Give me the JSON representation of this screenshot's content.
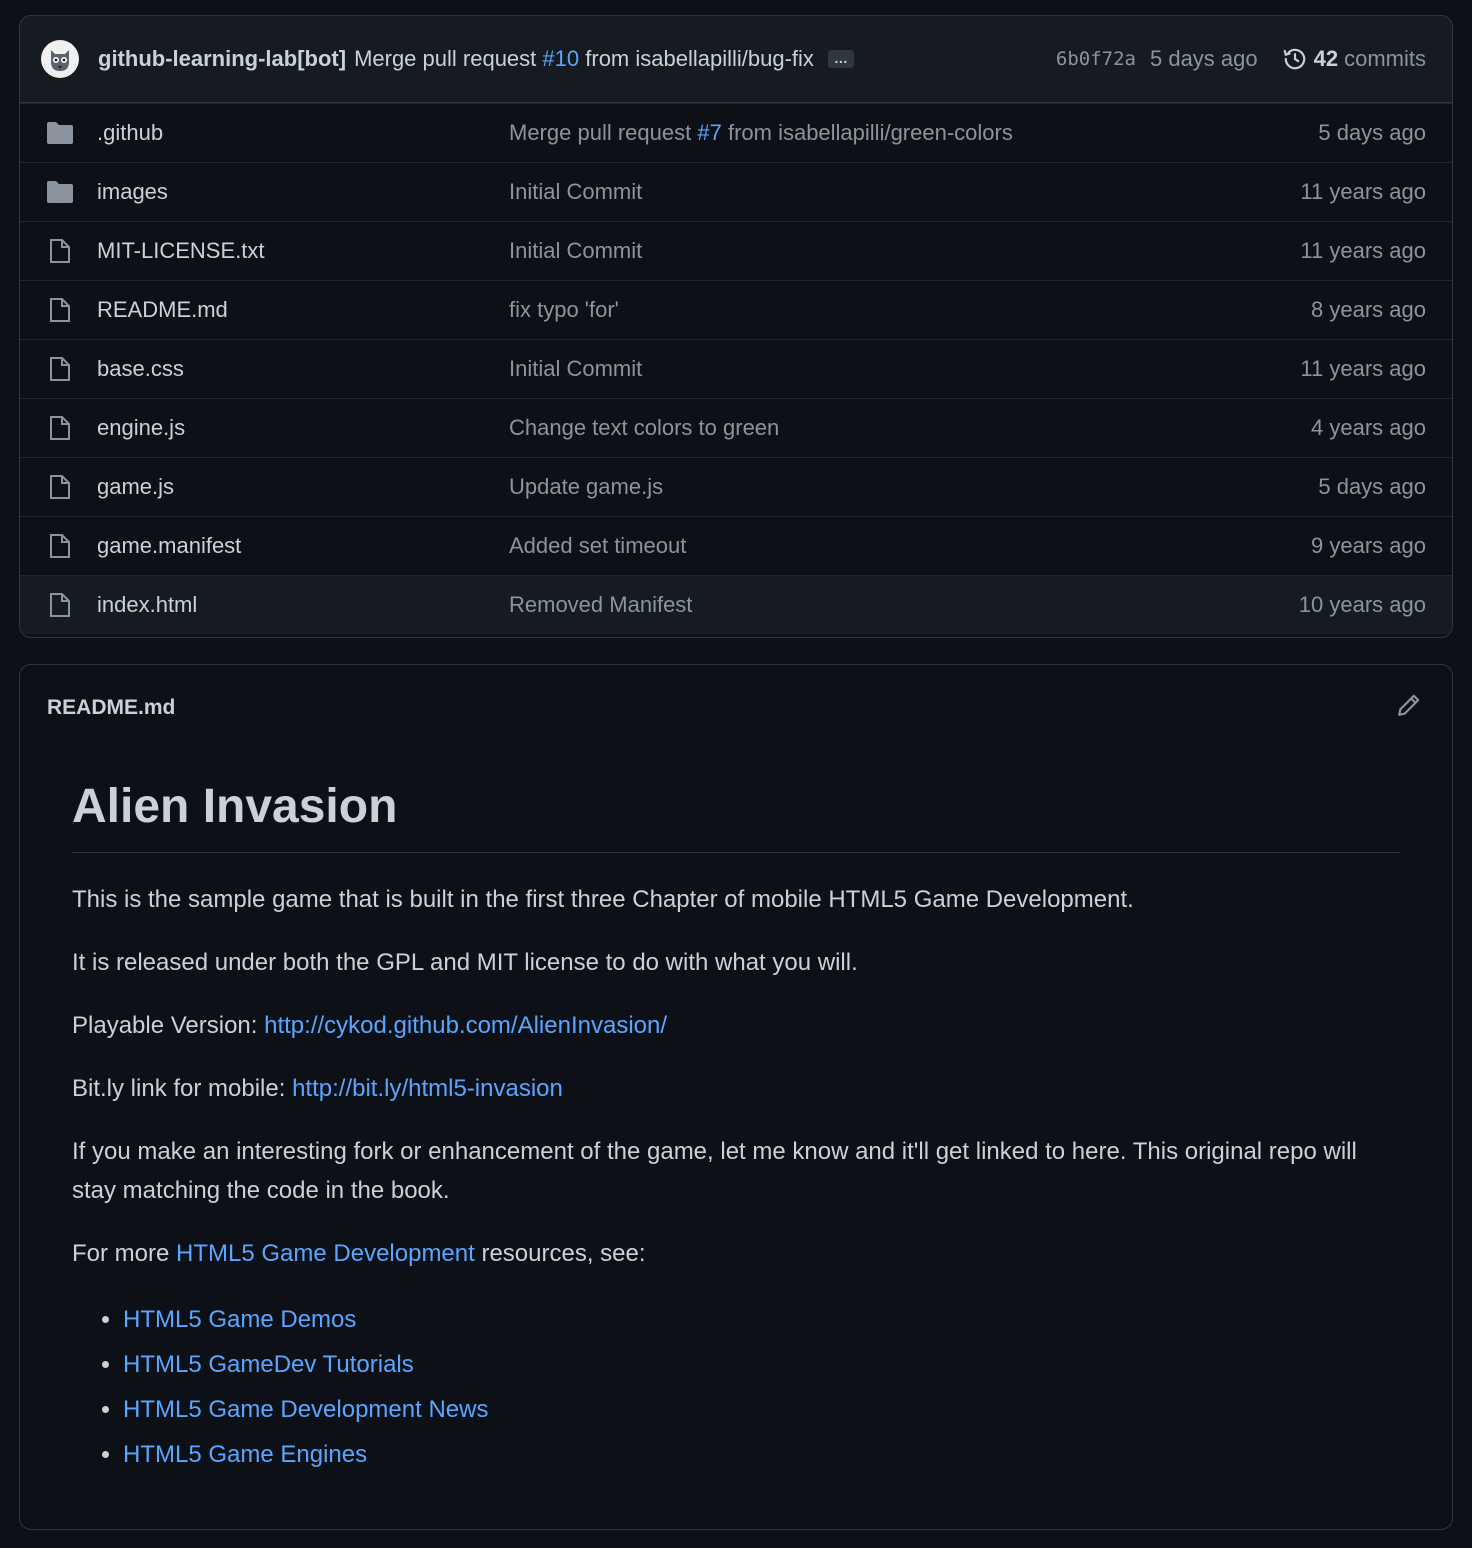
{
  "commit_bar": {
    "author": "github-learning-lab[bot]",
    "message_pre": "Merge pull request",
    "pr_link": "#10",
    "message_post": "from isabellapilli/bug-fix",
    "more": "…",
    "sha": "6b0f72a",
    "age": "5 days ago",
    "commits_count": "42",
    "commits_label": "commits"
  },
  "files": [
    {
      "name": ".github",
      "type": "folder",
      "msg_pre": "Merge pull request",
      "msg_link": "#7",
      "msg_post": "from isabellapilli/green-colors",
      "age": "5 days ago"
    },
    {
      "name": "images",
      "type": "folder",
      "msg": "Initial Commit",
      "age": "11 years ago"
    },
    {
      "name": "MIT-LICENSE.txt",
      "type": "file",
      "msg": "Initial Commit",
      "age": "11 years ago"
    },
    {
      "name": "README.md",
      "type": "file",
      "msg": "fix typo 'for'",
      "age": "8 years ago"
    },
    {
      "name": "base.css",
      "type": "file",
      "msg": "Initial Commit",
      "age": "11 years ago"
    },
    {
      "name": "engine.js",
      "type": "file",
      "msg": "Change text colors to green",
      "age": "4 years ago"
    },
    {
      "name": "game.js",
      "type": "file",
      "msg": "Update game.js",
      "age": "5 days ago"
    },
    {
      "name": "game.manifest",
      "type": "file",
      "msg": "Added set timeout",
      "age": "9 years ago"
    },
    {
      "name": "index.html",
      "type": "file",
      "msg": "Removed Manifest",
      "age": "10 years ago"
    }
  ],
  "readme": {
    "filename": "README.md",
    "title": "Alien Invasion",
    "p1": "This is the sample game that is built in the first three Chapter of mobile HTML5 Game Development.",
    "p2": "It is released under both the GPL and MIT license to do with what you will.",
    "p3_label": "Playable Version: ",
    "p3_link": "http://cykod.github.com/AlienInvasion/",
    "p4_label": "Bit.ly link for mobile: ",
    "p4_link": "http://bit.ly/html5-invasion",
    "p5": "If you make an interesting fork or enhancement of the game, let me know and it'll get linked to here. This original repo will stay matching the code in the book.",
    "p6_pre": "For more ",
    "p6_link": "HTML5 Game Development",
    "p6_post": " resources, see:",
    "links": [
      "HTML5 Game Demos",
      "HTML5 GameDev Tutorials",
      "HTML5 Game Development News",
      "HTML5 Game Engines"
    ]
  }
}
